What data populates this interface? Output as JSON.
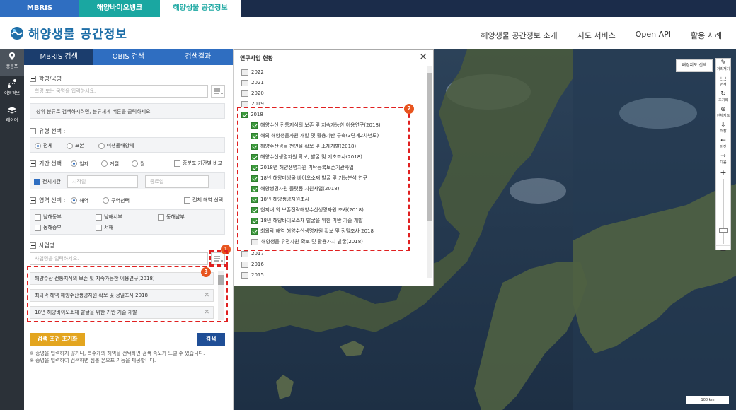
{
  "top_tabs": [
    {
      "label": "MBRIS",
      "color": "#2f6ec1"
    },
    {
      "label": "해양바이오뱅크",
      "color": "#1aa7a1"
    },
    {
      "label": "해양생물 공간정보",
      "color": "#ffffff"
    }
  ],
  "header": {
    "logo_text": "해양생물 공간정보",
    "nav": [
      "해양생물 공간정보 소개",
      "지도 서비스",
      "Open API",
      "활용 사례"
    ]
  },
  "rail": [
    {
      "label": "종분포",
      "icon": "map-pin-icon"
    },
    {
      "label": "이동정보",
      "icon": "route-icon"
    },
    {
      "label": "레이어",
      "icon": "layers-icon"
    }
  ],
  "panel": {
    "tabs": [
      "MBRIS 검색",
      "OBIS 검색",
      "검색결과"
    ],
    "name_section": "학명/국명",
    "name_placeholder": "학명 또는 국명을 입력하세요.",
    "taxonomy_hint": "상위 분류로 검색하시려면, 분류체계 버튼을 클릭하세요.",
    "type_section": "유형 선택 :",
    "type_options": [
      "전체",
      "표본",
      "미생물배양체"
    ],
    "period_section": "기간 선택 :",
    "period_options": [
      "일자",
      "계절",
      "월"
    ],
    "period_compare": "종분포 기간별 비교",
    "full_period": "전체기간",
    "start_placeholder": "시작일",
    "end_placeholder": "종료일",
    "area_section": "영역 선택 :",
    "area_options": [
      "해역",
      "구역선택"
    ],
    "area_all": "전체 해역 선택",
    "seas": [
      "남해동부",
      "남해서부",
      "동해남부",
      "동해중부",
      "서해"
    ],
    "project_section": "사업명",
    "project_placeholder": "사업명을 입력하세요.",
    "selected_projects": [
      "해양수산 전통지식의 보존 및 지속가능한 이용연구(2018)",
      "최외곽 해역 해양수산생명자원 확보 및 정밀조사 2018",
      "18년 해양바이오소재 발굴을 위한 기반 기술 개발"
    ],
    "reset_label": "검색 조건 초기화",
    "search_label": "검색",
    "notes": [
      "※ 종명을 입력하지 않거나, 복수개의 해역을 선택하면 검색 속도가 느릴 수 있습니다.",
      "※ 종명을 입력하여 검색하면 심볼 온오프 기능을 제공합니다."
    ]
  },
  "modal": {
    "title": "연구사업 현황",
    "years_top": [
      "2022",
      "2021",
      "2020",
      "2019"
    ],
    "open_year": "2018",
    "projects": [
      "해양수산 전통지식의 보존 및 지속가능한 이용연구(2018)",
      "해외 해양생물자원 개발 및 활용기반 구축(3단계2차년도)",
      "해양수산생물 천연물 확보 및 소재개발(2018)",
      "해양수산생명자원 확보, 발굴 및 기초조사(2018)",
      "2018년 해양생명자원 기탁등록보존기관사업",
      "18년 해양미생물 바이오소재 발굴 및 기능분석 연구",
      "해양생명자원 플랫폼 지원사업(2018)",
      "18년 해양생명자원조사",
      "현지내·외 보존전략해양수산생명자원 조사(2018)",
      "18년 해양바이오소재 발굴을 위한 기반 기술 개발",
      "최외곽 해역 해양수산생명자원 확보 및 정밀조사 2018",
      "해양생물 유전자원 확보 및 활용가치 발굴(2018)"
    ],
    "years_bottom": [
      "2017",
      "2016",
      "2015"
    ]
  },
  "map": {
    "basemap_button": "배경지도 선택",
    "tools": [
      "거리재기",
      "면적",
      "초기화",
      "전체지도",
      "저장",
      "이전",
      "다음"
    ],
    "scale": "100 km"
  },
  "badges": [
    "1",
    "2",
    "3"
  ],
  "colors": {
    "accent": "#2f6ec1",
    "highlight": "#e02020",
    "badge": "#e8541e"
  }
}
